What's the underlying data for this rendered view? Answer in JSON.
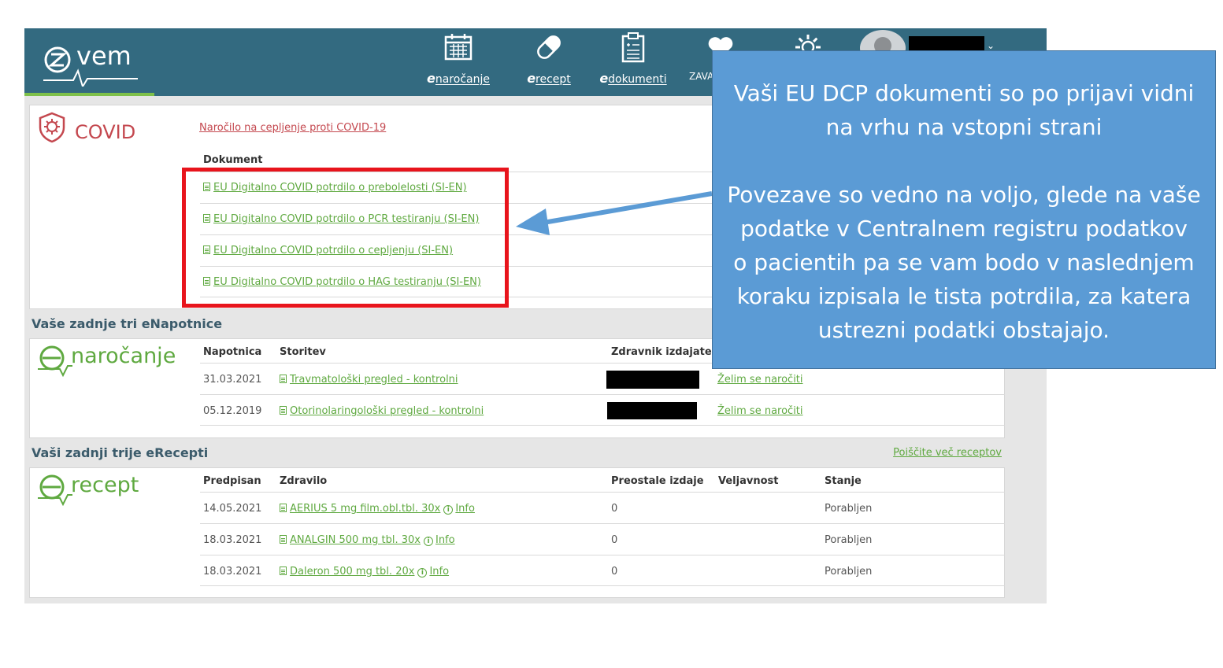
{
  "header": {
    "brand": "zvem",
    "nav": [
      {
        "prefix": "e",
        "label": "naročanje",
        "icon": "calendar-icon"
      },
      {
        "prefix": "e",
        "label": "recept",
        "icon": "pill-icon"
      },
      {
        "prefix": "e",
        "label": "dokumenti",
        "icon": "clipboard-icon"
      },
      {
        "prefix": "",
        "label": "ZAVA",
        "icon": "heart-icon"
      },
      {
        "prefix": "",
        "label": "",
        "icon": "gear-icon"
      }
    ]
  },
  "covid": {
    "title": "COVID",
    "order_link": "Naročilo na cepljenje proti COVID-19",
    "column": "Dokument",
    "documents": [
      "EU Digitalno COVID potrdilo o prebolelosti (SI-EN)",
      "EU Digitalno COVID potrdilo o PCR testiranju (SI-EN)",
      "EU Digitalno COVID potrdilo o cepljenju (SI-EN)",
      "EU Digitalno COVID potrdilo o HAG testiranju (SI-EN)"
    ]
  },
  "napotnice": {
    "heading": "Vaše zadnje tri eNapotnice",
    "logo": "naročanje",
    "columns": [
      "Napotnica",
      "Storitev",
      "Zdravnik izdajatelj"
    ],
    "rows": [
      {
        "date": "31.03.2021",
        "service": "Travmatološki pregled - kontrolni",
        "action": "Želim se naročiti"
      },
      {
        "date": "05.12.2019",
        "service": "Otorinolaringološki pregled - kontrolni",
        "action": "Želim se naročiti"
      }
    ]
  },
  "recepti": {
    "heading": "Vaši zadnji trije eRecepti",
    "more_link": "Poiščite več receptov",
    "logo": "recept",
    "columns": [
      "Predpisan",
      "Zdravilo",
      "Preostale izdaje",
      "Veljavnost",
      "Stanje"
    ],
    "info_label": "Info",
    "rows": [
      {
        "date": "14.05.2021",
        "drug": "AERIUS 5 mg film.obl.tbl. 30x",
        "remaining": "0",
        "validity": "",
        "status": "Porabljen"
      },
      {
        "date": "18.03.2021",
        "drug": "ANALGIN 500 mg tbl. 30x",
        "remaining": "0",
        "validity": "",
        "status": "Porabljen"
      },
      {
        "date": "18.03.2021",
        "drug": "Daleron 500 mg tbl. 20x",
        "remaining": "0",
        "validity": "",
        "status": "Porabljen"
      }
    ]
  },
  "callout": {
    "line1": "Vaši EU DCP dokumenti so po prijavi vidni",
    "line2": "na vrhu na vstopni strani",
    "line3": "Povezave so vedno na voljo, glede na vaše",
    "line4": "podatke v Centralnem registru podatkov",
    "line5": "o pacientih pa se vam bodo v naslednjem",
    "line6": "koraku izpisala le tista potrdila, za katera",
    "line7": "ustrezni podatki obstajajo."
  },
  "colors": {
    "header_bg": "#336a80",
    "accent_green": "#5fa940",
    "covid_red": "#c4484f",
    "highlight_red": "#e8141c",
    "callout_blue": "#5b9bd5"
  }
}
